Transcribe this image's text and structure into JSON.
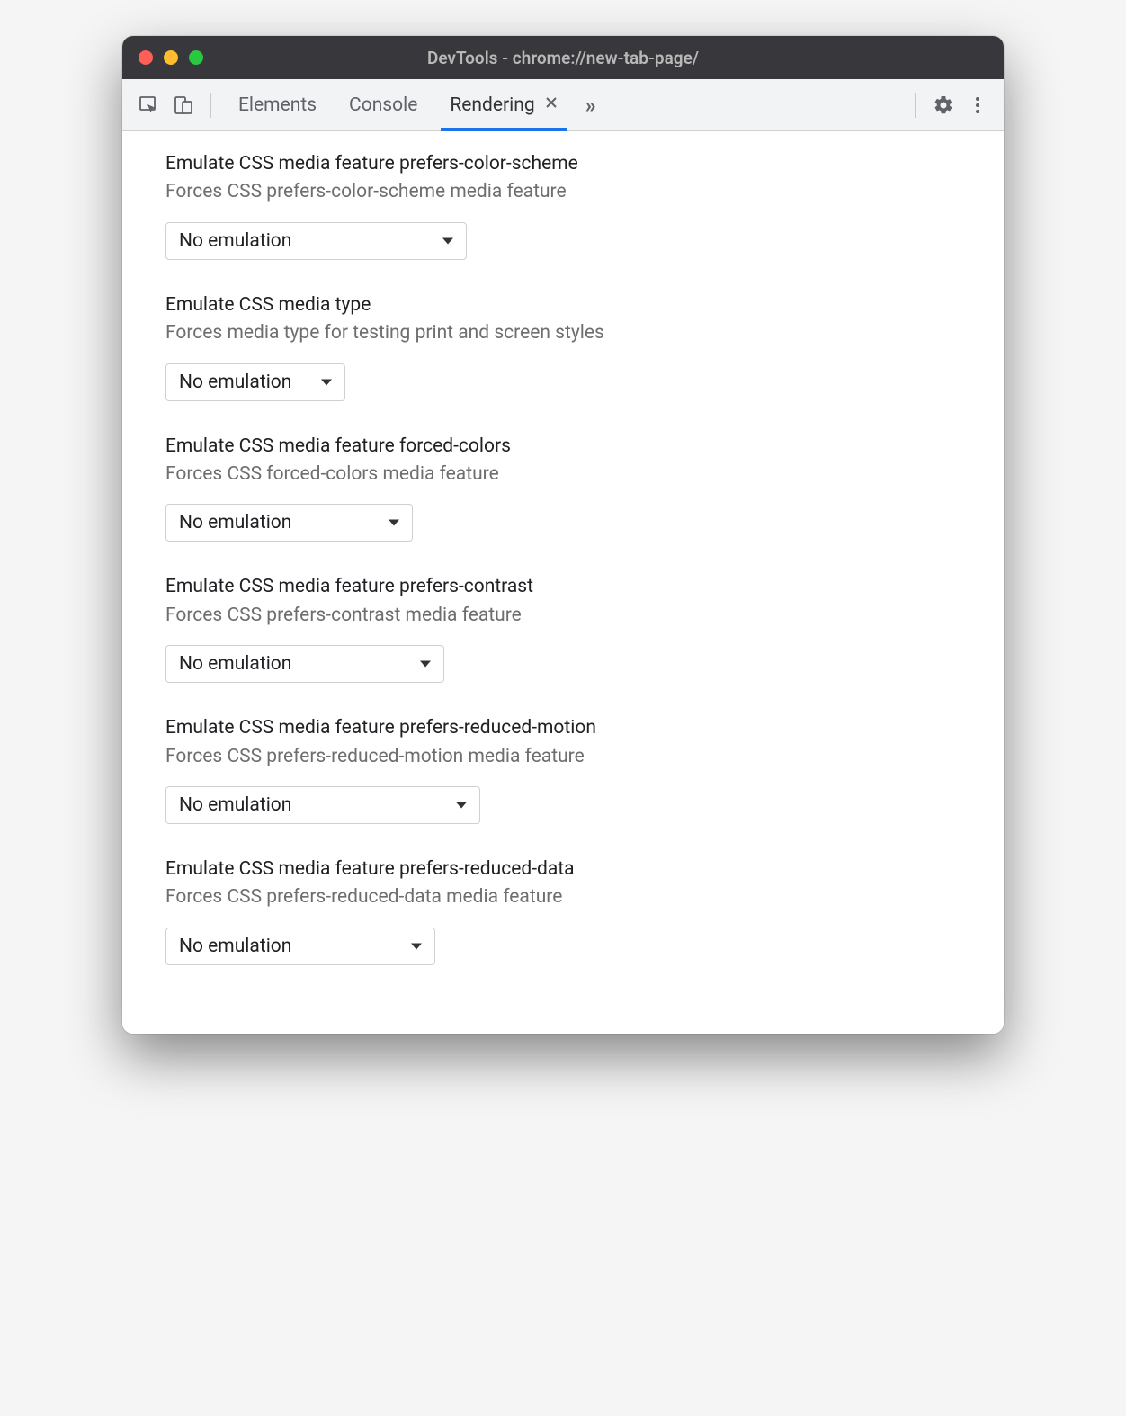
{
  "window": {
    "title": "DevTools - chrome://new-tab-page/"
  },
  "toolbar": {
    "tabs": [
      {
        "label": "Elements"
      },
      {
        "label": "Console"
      },
      {
        "label": "Rendering",
        "active": true
      }
    ]
  },
  "sections": [
    {
      "title": "Emulate CSS media feature prefers-color-scheme",
      "desc": "Forces CSS prefers-color-scheme media feature",
      "value": "No emulation",
      "widthClass": "w1"
    },
    {
      "title": "Emulate CSS media type",
      "desc": "Forces media type for testing print and screen styles",
      "value": "No emulation",
      "widthClass": "w2"
    },
    {
      "title": "Emulate CSS media feature forced-colors",
      "desc": "Forces CSS forced-colors media feature",
      "value": "No emulation",
      "widthClass": "w3"
    },
    {
      "title": "Emulate CSS media feature prefers-contrast",
      "desc": "Forces CSS prefers-contrast media feature",
      "value": "No emulation",
      "widthClass": "w4"
    },
    {
      "title": "Emulate CSS media feature prefers-reduced-motion",
      "desc": "Forces CSS prefers-reduced-motion media feature",
      "value": "No emulation",
      "widthClass": "w5"
    },
    {
      "title": "Emulate CSS media feature prefers-reduced-data",
      "desc": "Forces CSS prefers-reduced-data media feature",
      "value": "No emulation",
      "widthClass": "w6"
    }
  ]
}
